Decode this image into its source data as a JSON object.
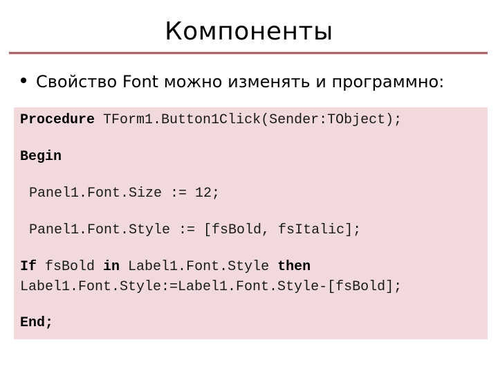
{
  "slide": {
    "title": "Компоненты",
    "bullet": "Свойство Font можно изменять и программно:",
    "colors": {
      "underline": "#a86a6a",
      "code_background": "#f1d9dc"
    }
  },
  "code": {
    "line1": {
      "kw": "Procedure",
      "rest": " TForm1.Button1Click(Sender:TObject);"
    },
    "line2": {
      "kw": "Begin"
    },
    "line3": {
      "text": "Panel1.Font.Size := 12;"
    },
    "line4": {
      "text": "Panel1.Font.Style := [fsBold, fsItalic];"
    },
    "line5": {
      "kw_if": "If",
      "part1": " fsBold ",
      "kw_in": "in",
      "part2": " Label1.Font.Style ",
      "kw_then": "then"
    },
    "line6": {
      "text": "Label1.Font.Style:=Label1.Font.Style-[fsBold];"
    },
    "line7": {
      "kw": "End;"
    }
  }
}
